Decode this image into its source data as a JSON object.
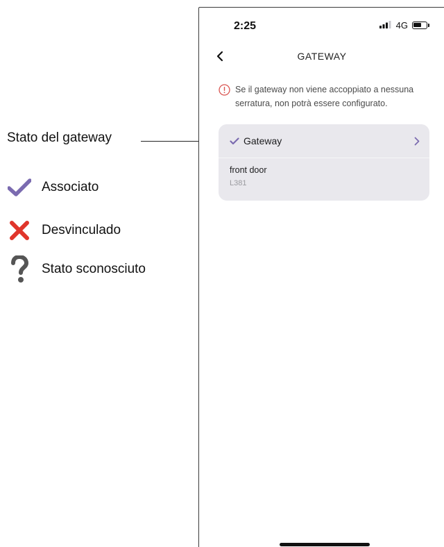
{
  "legend": {
    "callout": "Stato del gateway",
    "items": [
      {
        "icon": "check-icon",
        "label": "Associato",
        "color": "#7b6bb0"
      },
      {
        "icon": "cross-icon",
        "label": "Desvinculado",
        "color": "#e0352b"
      },
      {
        "icon": "question-icon",
        "label": "Stato sconosciuto",
        "color": "#555555"
      }
    ]
  },
  "status_bar": {
    "time": "2:25",
    "network": "4G"
  },
  "nav": {
    "title": "GATEWAY"
  },
  "warning": {
    "text": "Se il gateway non viene accoppiato a nessuna serratura, non potrà essere configurato.",
    "color": "#d9534f"
  },
  "gateway_card": {
    "gateway_label": "Gateway",
    "status_icon": "check-icon",
    "accent": "#7b6bb0",
    "lock_name": "front door",
    "lock_id": "L381"
  }
}
